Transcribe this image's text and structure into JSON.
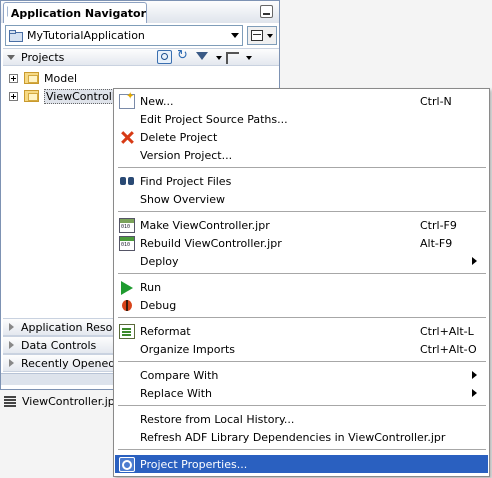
{
  "navigator": {
    "title": "Application Navigator",
    "application": "MyTutorialApplication",
    "projects_label": "Projects",
    "tree": [
      {
        "label": "Model"
      },
      {
        "label": "ViewControlle"
      }
    ],
    "sections": [
      {
        "label": "Application Resourc"
      },
      {
        "label": "Data Controls"
      },
      {
        "label": "Recently Opened F"
      }
    ]
  },
  "structure": {
    "file_label": "ViewController.jpr -"
  },
  "context_menu": {
    "items": [
      {
        "label": "New...",
        "shortcut": "Ctrl-N",
        "icon": "new-icon"
      },
      {
        "label": "Edit Project Source Paths...",
        "shortcut": ""
      },
      {
        "label": "Delete Project",
        "shortcut": "",
        "icon": "delete-icon"
      },
      {
        "label": "Version Project...",
        "shortcut": ""
      },
      {
        "label": "Find Project Files",
        "shortcut": "",
        "icon": "binoculars-icon"
      },
      {
        "label": "Show Overview",
        "shortcut": ""
      },
      {
        "label": "Make ViewController.jpr",
        "shortcut": "Ctrl-F9",
        "icon": "make-icon"
      },
      {
        "label": "Rebuild ViewController.jpr",
        "shortcut": "Alt-F9",
        "icon": "rebuild-icon"
      },
      {
        "label": "Deploy",
        "shortcut": "",
        "submenu": true
      },
      {
        "label": "Run",
        "shortcut": "",
        "icon": "run-icon"
      },
      {
        "label": "Debug",
        "shortcut": "",
        "icon": "debug-icon"
      },
      {
        "label": "Reformat",
        "shortcut": "Ctrl+Alt-L",
        "icon": "reformat-icon"
      },
      {
        "label": "Organize Imports",
        "shortcut": "Ctrl+Alt-O"
      },
      {
        "label": "Compare With",
        "shortcut": "",
        "submenu": true
      },
      {
        "label": "Replace With",
        "shortcut": "",
        "submenu": true
      },
      {
        "label": "Restore from Local History...",
        "shortcut": ""
      },
      {
        "label": "Refresh ADF Library Dependencies in ViewController.jpr",
        "shortcut": ""
      },
      {
        "label": "Project Properties...",
        "shortcut": "",
        "icon": "project-properties-icon",
        "highlighted": true
      }
    ],
    "highlight_color": "#2a60c0"
  }
}
